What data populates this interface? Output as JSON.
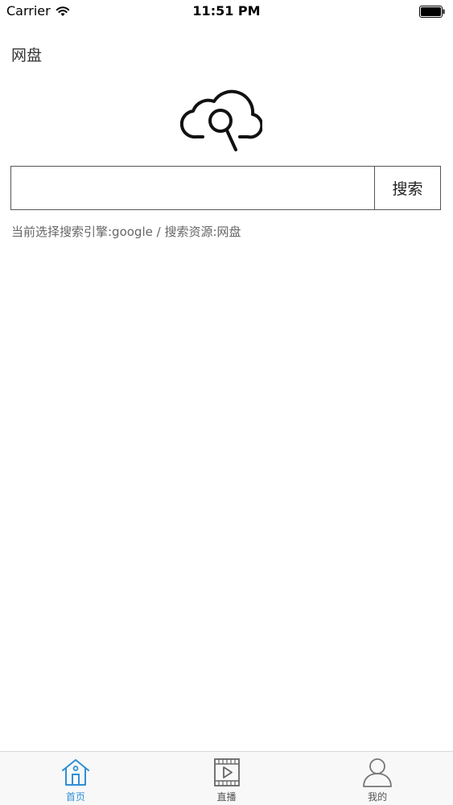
{
  "status_bar": {
    "carrier": "Carrier",
    "time": "11:51 PM"
  },
  "header": {
    "title": "网盘"
  },
  "logo": {
    "icon": "cloud-search-icon"
  },
  "search": {
    "value": "",
    "placeholder": "",
    "button_label": "搜索",
    "hint": "当前选择搜索引擎:google / 搜索资源:网盘"
  },
  "tab_bar": {
    "active_color": "#2f8fd6",
    "inactive_color": "#555555",
    "items": [
      {
        "label": "首页",
        "icon": "home-icon",
        "active": true
      },
      {
        "label": "直播",
        "icon": "video-play-icon",
        "active": false
      },
      {
        "label": "我的",
        "icon": "user-icon",
        "active": false
      }
    ]
  }
}
